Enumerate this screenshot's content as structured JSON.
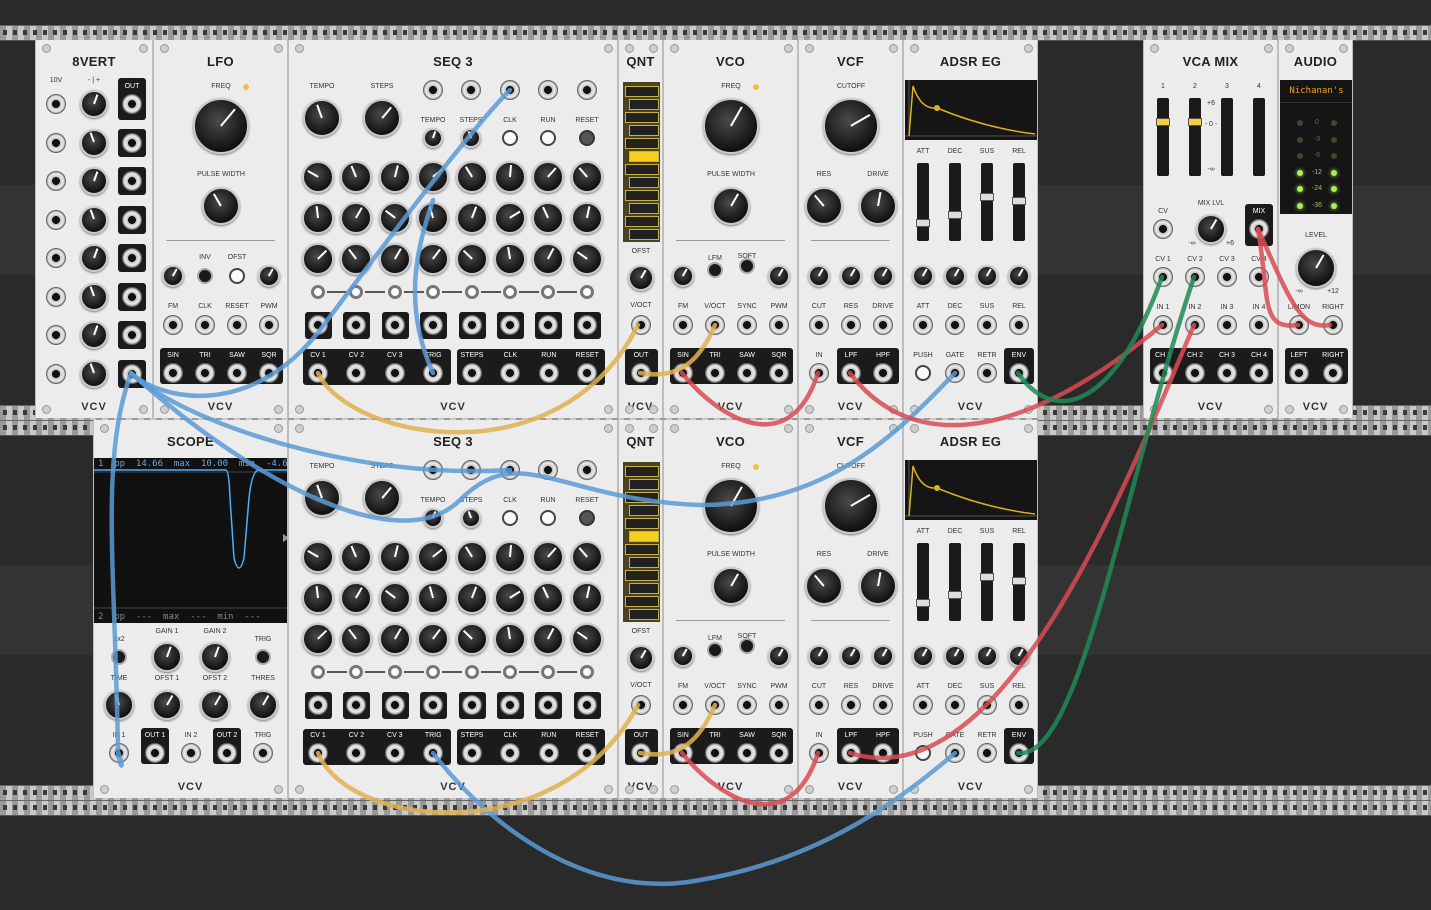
{
  "vcv_label": "VCV",
  "modules": {
    "eightvert": {
      "title": "8VERT",
      "labels": [
        "10V",
        "- | +",
        "OUT"
      ]
    },
    "lfo": {
      "title": "LFO",
      "freq": "FREQ",
      "pw": "PULSE WIDTH",
      "inv": "INV",
      "ofst": "OFST",
      "fm": "FM",
      "clk": "CLK",
      "reset": "RESET",
      "pwm": "PWM",
      "outs": [
        "SIN",
        "TRI",
        "SAW",
        "SQR"
      ]
    },
    "seq3": {
      "title": "SEQ 3",
      "tempo": "TEMPO",
      "steps": "STEPS",
      "clk": "CLK",
      "run": "RUN",
      "reset": "RESET",
      "outs_left": [
        "CV 1",
        "CV 2",
        "CV 3",
        "TRIG"
      ],
      "outs_right": [
        "STEPS",
        "CLK",
        "RUN",
        "RESET"
      ]
    },
    "qnt": {
      "title": "QNT",
      "ofst": "OFST",
      "voct": "V/OCT",
      "out": "OUT"
    },
    "vco": {
      "title": "VCO",
      "freq": "FREQ",
      "pw": "PULSE WIDTH",
      "lfm": "LFM",
      "soft": "SOFT",
      "fm": "FM",
      "voct": "V/OCT",
      "sync": "SYNC",
      "pwm": "PWM",
      "outs": [
        "SIN",
        "TRI",
        "SAW",
        "SQR"
      ]
    },
    "vcf": {
      "title": "VCF",
      "cutoff": "CUTOFF",
      "res": "RES",
      "drive": "DRIVE",
      "cut": "CUT",
      "in": "IN",
      "lpf": "LPF",
      "hpf": "HPF"
    },
    "adsr": {
      "title": "ADSR EG",
      "att": "ATT",
      "dec": "DEC",
      "sus": "SUS",
      "rel": "REL",
      "push": "PUSH",
      "gate": "GATE",
      "retr": "RETR",
      "env": "ENV"
    },
    "vcamix": {
      "title": "VCA MIX",
      "ch": [
        "1",
        "2",
        "3",
        "4"
      ],
      "scale": [
        "+6",
        "- 0 -",
        "-∞"
      ],
      "mixlvl": "MIX LVL",
      "cv": "CV",
      "mix": "MIX",
      "minf": "-∞",
      "plus6": "+6",
      "cvs": [
        "CV 1",
        "CV 2",
        "CV 3",
        "CV 4"
      ],
      "ins": [
        "IN 1",
        "IN 2",
        "IN 3",
        "IN 4"
      ],
      "outs": [
        "CH 1",
        "CH 2",
        "CH 3",
        "CH 4"
      ]
    },
    "audio": {
      "title": "AUDIO",
      "device": "Nichanan's",
      "meter": [
        "0",
        "-3",
        "-6",
        "-12",
        "-24",
        "-36"
      ],
      "level": "LEVEL",
      "minf": "-∞",
      "plus12": "+12",
      "lmon": "L/MON",
      "right": "RIGHT",
      "outs": [
        "LEFT",
        "RIGHT"
      ]
    },
    "scope": {
      "title": "SCOPE",
      "readout_top": "1  pp  14.66  max  10.00  min  -4.66",
      "readout_bottom": "2  pp  ---  max  ---  min  ---",
      "x2": "1x2",
      "gain1": "GAIN 1",
      "gain2": "GAIN 2",
      "trig": "TRIG",
      "time": "TIME",
      "ofst1": "OFST 1",
      "ofst2": "OFST 2",
      "thres": "THRES",
      "in1": "IN 1",
      "in2": "IN 2",
      "out1": "OUT 1",
      "out2": "OUT 2"
    }
  },
  "colors": {
    "blue": "#5b9bd5",
    "yellow": "#e0b050",
    "red": "#d94a55",
    "green": "#1e8a55"
  }
}
